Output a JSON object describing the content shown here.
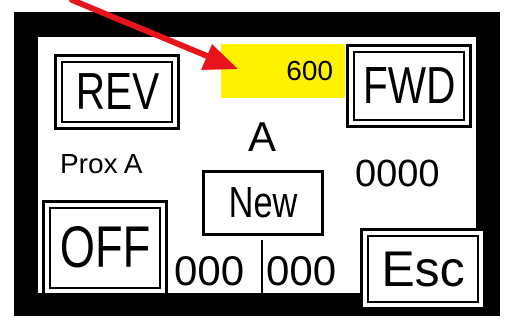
{
  "controls": {
    "rev_label": "REV",
    "fwd_label": "FWD",
    "off_label": "OFF",
    "esc_label": "Esc",
    "new_label": "New"
  },
  "display": {
    "setpoint_value": "600",
    "channel_letter": "A",
    "sensor_label": "Prox A",
    "count_value": "0000",
    "counter_left": "000",
    "counter_right": "000"
  },
  "colors": {
    "highlight": "#fff200",
    "arrow": "#e8141c",
    "bezel": "#000000"
  }
}
